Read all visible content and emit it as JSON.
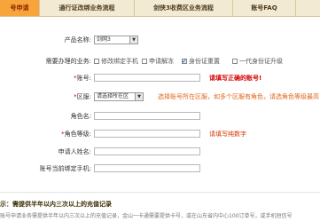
{
  "tabs": [
    {
      "label": "号申请"
    },
    {
      "label": "通行证改绑业务流程"
    },
    {
      "label": "剑侠3收费区业务流程"
    },
    {
      "label": "账号FAQ"
    }
  ],
  "form": {
    "product_label": "产品名称:",
    "product_value": "剑网3",
    "services_label": "需要办理的业务:",
    "services": [
      {
        "label": "修改绑定手机",
        "checked": false
      },
      {
        "label": "申请解冻",
        "checked": false
      },
      {
        "label": "身份证重置",
        "checked": true
      },
      {
        "label": "一代身份证升级",
        "checked": false
      }
    ],
    "account_label": "*账号:",
    "account_hint": "请填写正确的账号!",
    "zone_label": "*区服:",
    "zone_select": "请选择所在区",
    "zone_hint": "选择账号所在区服，如多个区服有角色，请选角色等级最高",
    "role_label": "角色名:",
    "role_level_label": "*角色等级:",
    "role_level_hint": "请填写纯数字",
    "applicant_label": "申请人姓名:",
    "phone_label": "账号当前绑定手机:"
  },
  "note": {
    "title": "示：需提供半年以内三次以上的充值记录",
    "text": "账号申请业务需提供半年以内三次以上的充值记录，金山一卡通需要提供卡号，或在山东省内中心100订单号，或手机短信号"
  }
}
